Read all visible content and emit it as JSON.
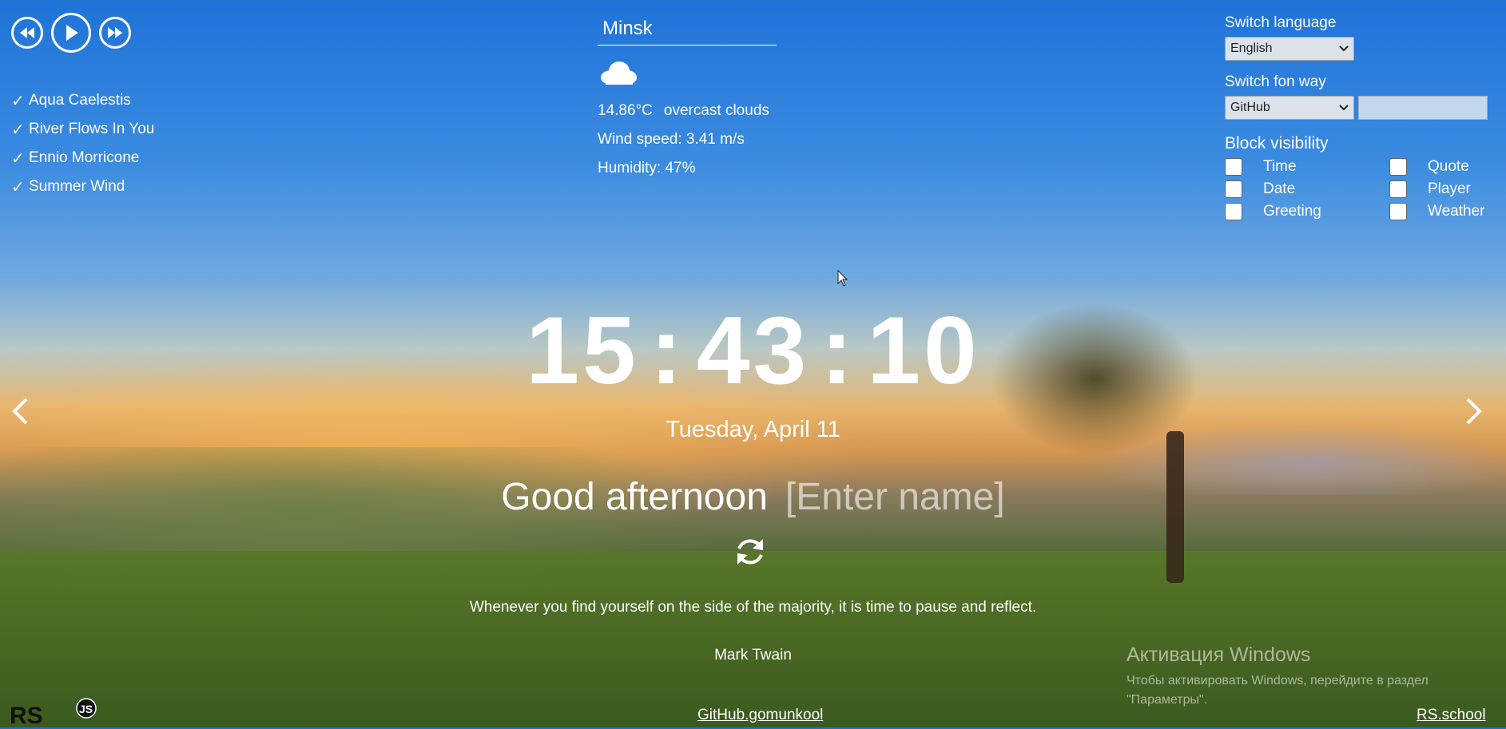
{
  "player": {
    "tracks": [
      "Aqua Caelestis",
      "River Flows In You",
      "Ennio Morricone",
      "Summer Wind"
    ]
  },
  "weather": {
    "city": "Minsk",
    "temperature": "14.86°C",
    "description": "overcast clouds",
    "wind": "Wind speed: 3.41 m/s",
    "humidity": "Humidity: 47%"
  },
  "settings": {
    "language_title": "Switch language",
    "language_value": "English",
    "source_title": "Switch fon way",
    "source_value": "GitHub",
    "visibility_title": "Block visibility",
    "blocks": [
      "Time",
      "Quote",
      "Date",
      "Player",
      "Greeting",
      "Weather"
    ]
  },
  "clock": {
    "h": "15",
    "m": "43",
    "s": "10",
    "sep": ":"
  },
  "date": "Tuesday, April 11",
  "greeting": {
    "text": "Good afternoon",
    "name_placeholder": "[Enter name]"
  },
  "quote": {
    "text": "Whenever you find yourself on the side of the majority, it is time to pause and reflect.",
    "author": "Mark Twain"
  },
  "footer": {
    "github_link": "GitHub.gomunkool",
    "rs_link": "RS.school",
    "logo_text": "RS",
    "logo_badge": "JS"
  },
  "windows_overlay": {
    "title": "Активация Windows",
    "line1": "Чтобы активировать Windows, перейдите в раздел",
    "line2": "\"Параметры\"."
  },
  "icons": {
    "prev_track": "rewind-icon",
    "play": "play-icon",
    "next_track": "fast-forward-icon",
    "weather": "cloud-icon",
    "refresh_quote": "refresh-icon",
    "slide_prev": "chevron-left-icon",
    "slide_next": "chevron-right-icon"
  }
}
